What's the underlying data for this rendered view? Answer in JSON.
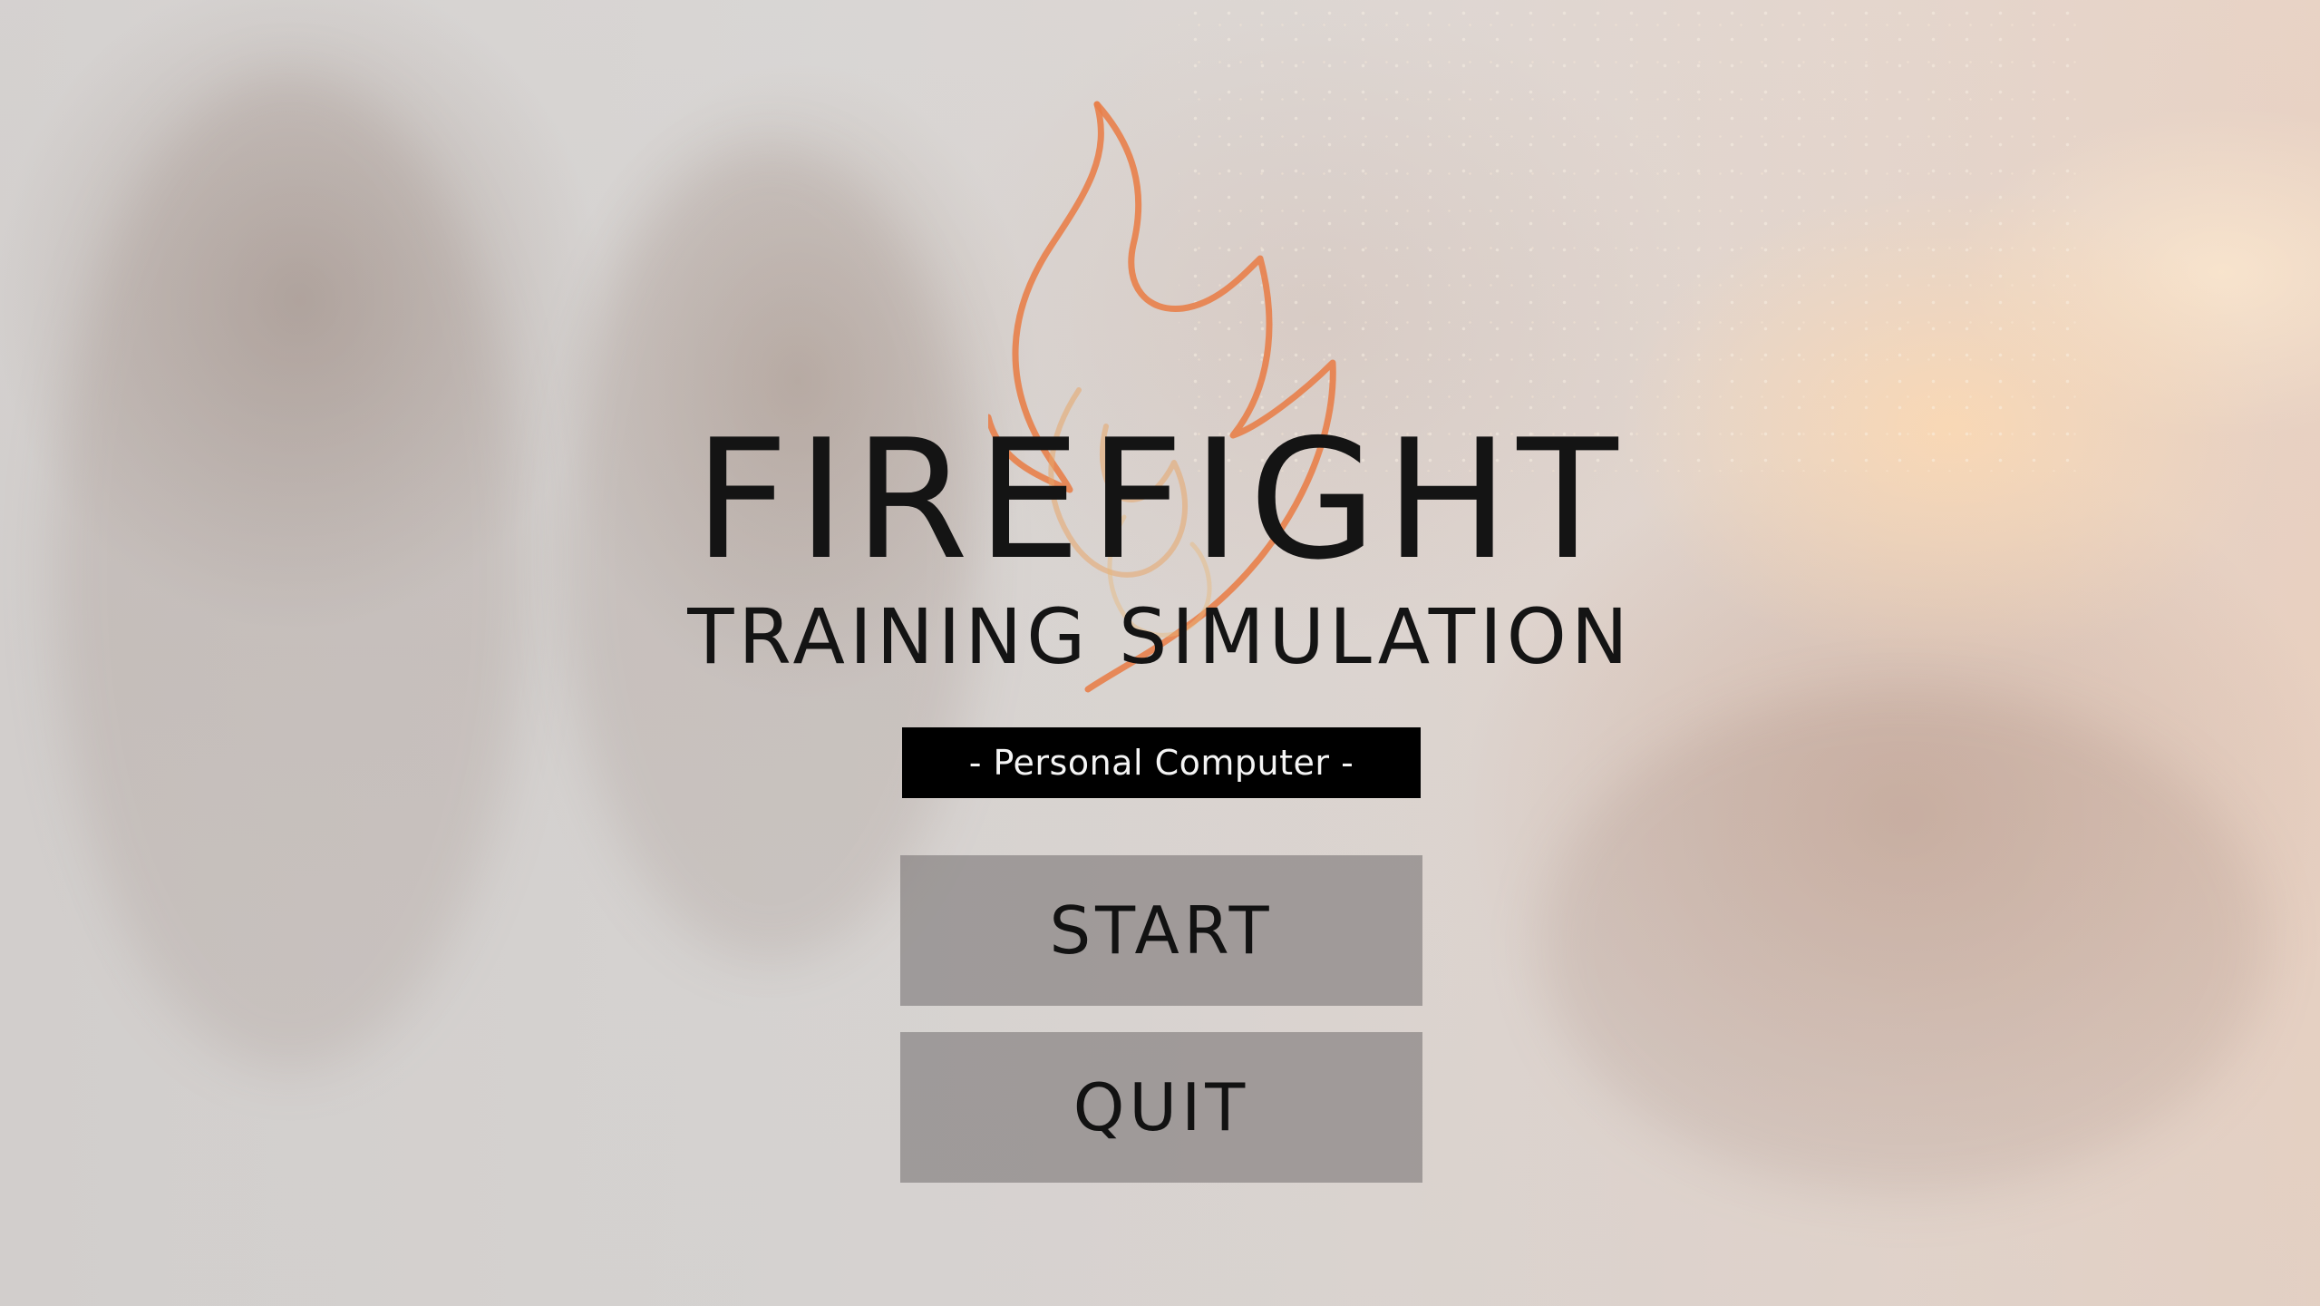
{
  "game": {
    "title": "FIREFIGHT",
    "subtitle": "TRAINING SIMULATION",
    "platform_label": "-  Personal Computer -"
  },
  "menu": {
    "start_label": "START",
    "quit_label": "QUIT"
  },
  "logo": {
    "icon": "flame-outline-icon",
    "flame_color": "#e8804a"
  },
  "colors": {
    "title_text": "#141414",
    "badge_bg": "#000000",
    "badge_text": "#f4f4f4",
    "button_bg": "#7d7878"
  }
}
